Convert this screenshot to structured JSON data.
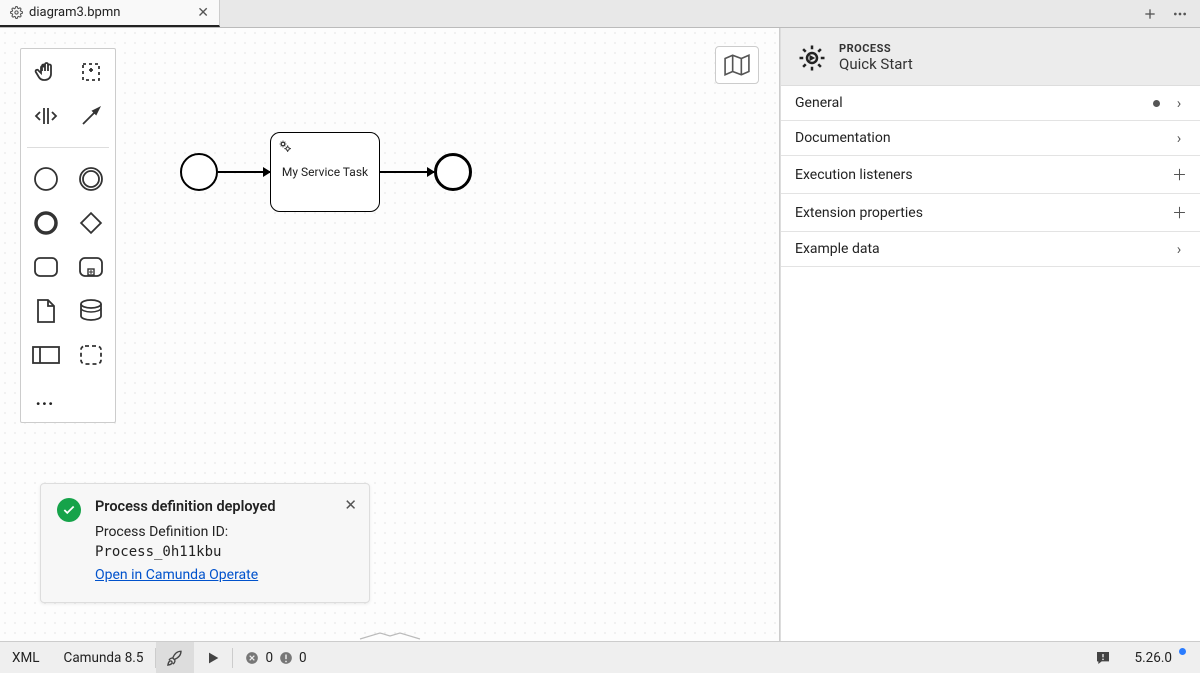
{
  "tab": {
    "title": "diagram3.bpmn"
  },
  "palette": {
    "more_label": "..."
  },
  "diagram": {
    "task_label": "My Service Task"
  },
  "toast": {
    "title": "Process definition deployed",
    "id_label": "Process Definition ID: ",
    "id_value": "Process_0h11kbu",
    "link_label": "Open in Camunda Operate"
  },
  "panel": {
    "type": "PROCESS",
    "name": "Quick Start",
    "rows": {
      "general": "General",
      "documentation": "Documentation",
      "exec_listeners": "Execution listeners",
      "ext_props": "Extension properties",
      "example_data": "Example data"
    }
  },
  "statusbar": {
    "xml": "XML",
    "platform": "Camunda 8.5",
    "err_count": "0",
    "warn_count": "0",
    "version": "5.26.0"
  }
}
